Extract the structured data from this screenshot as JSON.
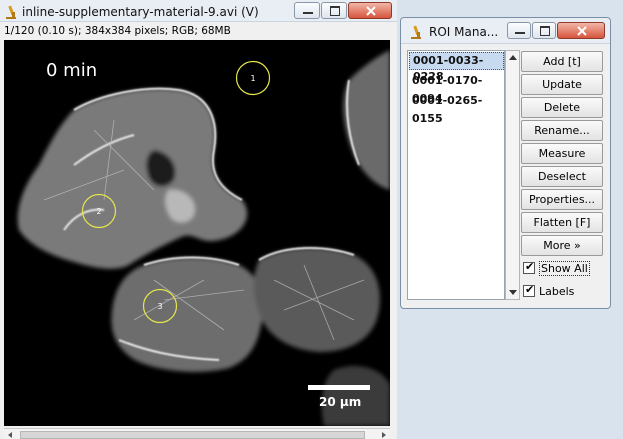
{
  "image_window": {
    "title": "inline-supplementary-material-9.avi (V)",
    "info": "1/120 (0.10 s); 384x384 pixels; RGB; 68MB",
    "time_label": "0 min",
    "scale_bar_label": "20 µm",
    "rois": [
      {
        "label": "1"
      },
      {
        "label": "2"
      },
      {
        "label": "3"
      }
    ],
    "roi_color": "#e6e64d"
  },
  "roi_manager": {
    "title": "ROI Mana...",
    "items": [
      {
        "label": "0001-0033-0228",
        "selected": true
      },
      {
        "label": "0001-0170-0094",
        "selected": false
      },
      {
        "label": "0001-0265-0155",
        "selected": false
      }
    ],
    "buttons": {
      "add": "Add [t]",
      "update": "Update",
      "delete": "Delete",
      "rename": "Rename...",
      "measure": "Measure",
      "deselect": "Deselect",
      "properties": "Properties...",
      "flatten": "Flatten [F]",
      "more": "More »"
    },
    "checkboxes": {
      "show_all": {
        "label": "Show All",
        "checked": true
      },
      "labels": {
        "label": "Labels",
        "checked": true
      }
    }
  }
}
